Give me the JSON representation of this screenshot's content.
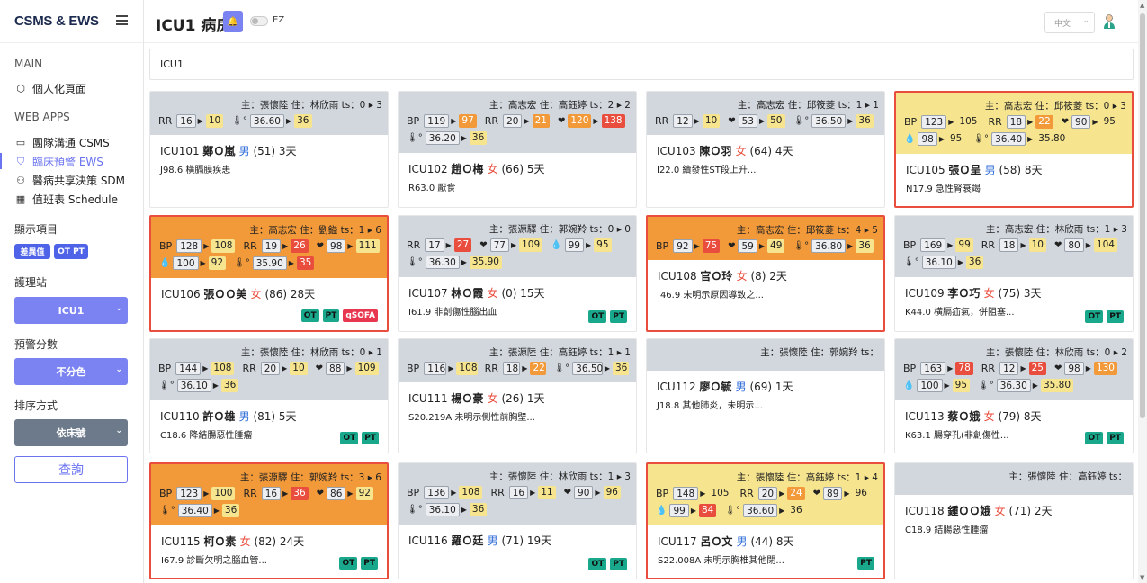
{
  "app": {
    "brand": "CSMS & EWS",
    "page_title": "ICU1 病房",
    "ez_label": "EZ",
    "lang": "中文"
  },
  "sidebar": {
    "main_section": "MAIN",
    "personal": "個人化頁面",
    "webapps_section": "WEB APPS",
    "items": [
      {
        "label": "團隊溝通 CSMS",
        "icon": "chat-icon"
      },
      {
        "label": "臨床預警 EWS",
        "icon": "shield-icon"
      },
      {
        "label": "醫病共享決策 SDM",
        "icon": "users-icon"
      },
      {
        "label": "值班表 Schedule",
        "icon": "calendar-icon"
      }
    ],
    "display_section": "顯示項目",
    "pills": [
      "差異值",
      "OT PT"
    ],
    "station_label": "護理站",
    "station_value": "ICU1",
    "score_label": "預警分數",
    "score_value": "不分色",
    "sort_label": "排序方式",
    "sort_value": "依床號",
    "query": "查詢"
  },
  "filter": {
    "value": "ICU1"
  },
  "cards": [
    {
      "theme": "gray",
      "alert": false,
      "doc": "主：張懷陸 住：林欣雨 ts：0 ▸ 3",
      "rows": [
        [
          [
            "label",
            "RR"
          ],
          [
            "g",
            "16"
          ],
          [
            "arr"
          ],
          [
            "y",
            "10"
          ],
          [
            "gap"
          ],
          [
            "ico",
            "🌡°"
          ],
          [
            "g",
            "36.60"
          ],
          [
            "arr"
          ],
          [
            "y",
            "36"
          ]
        ]
      ],
      "name": "ICU101",
      "pname": "鄭Ｏ嵐",
      "sex": "男",
      "sexc": "m",
      "info": "(51) 3天",
      "diag": "J98.6 橫膈膜疾患",
      "tags": []
    },
    {
      "theme": "gray",
      "alert": false,
      "doc": "主：高志宏 住：高鈺婷 ts：2 ▸ 2",
      "rows": [
        [
          [
            "label",
            "BP"
          ],
          [
            "g",
            "119"
          ],
          [
            "arr"
          ],
          [
            "o",
            "97"
          ],
          [
            "gap"
          ],
          [
            "label",
            "RR"
          ],
          [
            "g",
            "20"
          ],
          [
            "arr"
          ],
          [
            "o",
            "21"
          ],
          [
            "gap"
          ],
          [
            "ico",
            "❤"
          ],
          [
            "o",
            "120"
          ],
          [
            "arr"
          ],
          [
            "r",
            "138"
          ]
        ],
        [
          [
            "ico",
            "🌡°"
          ],
          [
            "g",
            "36.20"
          ],
          [
            "arr"
          ],
          [
            "y",
            "36"
          ]
        ]
      ],
      "name": "ICU102",
      "pname": "趙Ｏ梅",
      "sex": "女",
      "sexc": "f",
      "info": "(66) 5天",
      "diag": "R63.0 厭食",
      "tags": []
    },
    {
      "theme": "gray",
      "alert": false,
      "doc": "主：高志宏 住：邱筱菱 ts：1 ▸ 1",
      "rows": [
        [
          [
            "label",
            "RR"
          ],
          [
            "g",
            "12"
          ],
          [
            "arr"
          ],
          [
            "y",
            "10"
          ],
          [
            "gap"
          ],
          [
            "ico",
            "❤"
          ],
          [
            "g",
            "53"
          ],
          [
            "arr"
          ],
          [
            "y",
            "50"
          ],
          [
            "gap"
          ],
          [
            "ico",
            "🌡°"
          ],
          [
            "g",
            "36.50"
          ],
          [
            "arr"
          ],
          [
            "y",
            "36"
          ]
        ]
      ],
      "name": "ICU103",
      "pname": "陳Ｏ羽",
      "sex": "女",
      "sexc": "f",
      "info": "(64) 4天",
      "diag": "I22.0 續發性ST段上升...",
      "tags": []
    },
    {
      "theme": "yellow",
      "alert": true,
      "doc": "主：高志宏 住：邱筱菱 ts：0 ▸ 3",
      "rows": [
        [
          [
            "label",
            "BP"
          ],
          [
            "g",
            "123"
          ],
          [
            "arr"
          ],
          [
            "y",
            "105"
          ],
          [
            "gap"
          ],
          [
            "label",
            "RR"
          ],
          [
            "g",
            "18"
          ],
          [
            "arr"
          ],
          [
            "o",
            "22"
          ],
          [
            "gap"
          ],
          [
            "ico",
            "❤"
          ],
          [
            "g",
            "90"
          ],
          [
            "arr"
          ],
          [
            "y",
            "95"
          ]
        ],
        [
          [
            "ico",
            "💧"
          ],
          [
            "g",
            "98"
          ],
          [
            "arr"
          ],
          [
            "y",
            "95"
          ],
          [
            "gap"
          ],
          [
            "ico",
            "🌡°"
          ],
          [
            "g",
            "36.40"
          ],
          [
            "arr"
          ],
          [
            "y",
            "35.80"
          ]
        ]
      ],
      "name": "ICU105",
      "pname": "張Ｏ呈",
      "sex": "男",
      "sexc": "m",
      "info": "(58) 8天",
      "diag": "N17.9 急性腎衰竭",
      "tags": []
    },
    {
      "theme": "orange",
      "alert": true,
      "doc": "主：高志宏 住：劉鎰 ts：1 ▸ 6",
      "rows": [
        [
          [
            "label",
            "BP"
          ],
          [
            "g",
            "128"
          ],
          [
            "arr"
          ],
          [
            "y",
            "108"
          ],
          [
            "gap"
          ],
          [
            "label",
            "RR"
          ],
          [
            "g",
            "19"
          ],
          [
            "arr"
          ],
          [
            "r",
            "26"
          ],
          [
            "gap"
          ],
          [
            "ico",
            "❤"
          ],
          [
            "g",
            "98"
          ],
          [
            "arr"
          ],
          [
            "y",
            "111"
          ]
        ],
        [
          [
            "ico",
            "💧"
          ],
          [
            "g",
            "100"
          ],
          [
            "arr"
          ],
          [
            "y",
            "92"
          ],
          [
            "gap"
          ],
          [
            "ico",
            "🌡°"
          ],
          [
            "g",
            "35.90"
          ],
          [
            "arr"
          ],
          [
            "r",
            "35"
          ]
        ]
      ],
      "name": "ICU106",
      "pname": "張ＯＯ美",
      "sex": "女",
      "sexc": "f",
      "info": "(86) 28天",
      "diag": "",
      "tags": [
        "OT",
        "PT",
        "qSOFA"
      ]
    },
    {
      "theme": "gray",
      "alert": false,
      "doc": "主：張源驛 住：郭婉羚 ts：0 ▸ 0",
      "rows": [
        [
          [
            "label",
            "RR"
          ],
          [
            "g",
            "17"
          ],
          [
            "arr"
          ],
          [
            "r",
            "27"
          ],
          [
            "gap"
          ],
          [
            "ico",
            "❤"
          ],
          [
            "g",
            "77"
          ],
          [
            "arr"
          ],
          [
            "y",
            "109"
          ],
          [
            "gap"
          ],
          [
            "ico",
            "💧"
          ],
          [
            "g",
            "99"
          ],
          [
            "arr"
          ],
          [
            "y",
            "95"
          ]
        ],
        [
          [
            "ico",
            "🌡°"
          ],
          [
            "g",
            "36.30"
          ],
          [
            "arr"
          ],
          [
            "y",
            "35.90"
          ]
        ]
      ],
      "name": "ICU107",
      "pname": "林Ｏ霞",
      "sex": "女",
      "sexc": "f",
      "info": "(0) 15天",
      "diag": "I61.9 非創傷性腦出血",
      "tags": [
        "OT",
        "PT"
      ]
    },
    {
      "theme": "orange",
      "alert": true,
      "doc": "主：高志宏 住：邱筱菱 ts：4 ▸ 5",
      "rows": [
        [
          [
            "label",
            "BP"
          ],
          [
            "g",
            "92"
          ],
          [
            "arr"
          ],
          [
            "r",
            "75"
          ],
          [
            "gap"
          ],
          [
            "ico",
            "❤"
          ],
          [
            "g",
            "59"
          ],
          [
            "arr"
          ],
          [
            "y",
            "49"
          ],
          [
            "gap"
          ],
          [
            "ico",
            "🌡°"
          ],
          [
            "g",
            "36.80"
          ],
          [
            "arr"
          ],
          [
            "y",
            "36"
          ]
        ]
      ],
      "name": "ICU108",
      "pname": "官Ｏ玲",
      "sex": "女",
      "sexc": "f",
      "info": "(8) 2天",
      "diag": "I46.9 未明示原因導致之...",
      "tags": []
    },
    {
      "theme": "gray",
      "alert": false,
      "doc": "主：高志宏 住：林欣雨 ts：1 ▸ 3",
      "rows": [
        [
          [
            "label",
            "BP"
          ],
          [
            "g",
            "169"
          ],
          [
            "arr"
          ],
          [
            "y",
            "99"
          ],
          [
            "gap"
          ],
          [
            "label",
            "RR"
          ],
          [
            "g",
            "18"
          ],
          [
            "arr"
          ],
          [
            "y",
            "10"
          ],
          [
            "gap"
          ],
          [
            "ico",
            "❤"
          ],
          [
            "g",
            "80"
          ],
          [
            "arr"
          ],
          [
            "y",
            "104"
          ]
        ],
        [
          [
            "ico",
            "🌡°"
          ],
          [
            "g",
            "36.10"
          ],
          [
            "arr"
          ],
          [
            "y",
            "36"
          ]
        ]
      ],
      "name": "ICU109",
      "pname": "李Ｏ巧",
      "sex": "女",
      "sexc": "f",
      "info": "(75) 3天",
      "diag": "K44.0 橫膈疝氣，併阻塞...",
      "tags": [
        "OT",
        "PT"
      ]
    },
    {
      "theme": "gray",
      "alert": false,
      "doc": "主：張懷陸 住：林欣雨 ts：0 ▸ 1",
      "rows": [
        [
          [
            "label",
            "BP"
          ],
          [
            "g",
            "144"
          ],
          [
            "arr"
          ],
          [
            "y",
            "108"
          ],
          [
            "gap"
          ],
          [
            "label",
            "RR"
          ],
          [
            "g",
            "20"
          ],
          [
            "arr"
          ],
          [
            "y",
            "10"
          ],
          [
            "gap"
          ],
          [
            "ico",
            "❤"
          ],
          [
            "g",
            "88"
          ],
          [
            "arr"
          ],
          [
            "y",
            "109"
          ]
        ],
        [
          [
            "ico",
            "🌡°"
          ],
          [
            "g",
            "36.10"
          ],
          [
            "arr"
          ],
          [
            "y",
            "36"
          ]
        ]
      ],
      "name": "ICU110",
      "pname": "許Ｏ雄",
      "sex": "男",
      "sexc": "m",
      "info": "(81) 5天",
      "diag": "C18.6 降結腸惡性腫瘤",
      "tags": [
        "OT",
        "PT"
      ]
    },
    {
      "theme": "gray",
      "alert": false,
      "doc": "主：張源陸 住：高鈺婷 ts：1 ▸ 1",
      "rows": [
        [
          [
            "label",
            "BP"
          ],
          [
            "g",
            "116"
          ],
          [
            "arr"
          ],
          [
            "y",
            "108"
          ],
          [
            "gap"
          ],
          [
            "label",
            "RR"
          ],
          [
            "g",
            "18"
          ],
          [
            "arr"
          ],
          [
            "o",
            "22"
          ],
          [
            "gap"
          ],
          [
            "ico",
            "🌡°"
          ],
          [
            "g",
            "36.50"
          ],
          [
            "arr"
          ],
          [
            "y",
            "36"
          ]
        ]
      ],
      "name": "ICU111",
      "pname": "楊Ｏ豪",
      "sex": "女",
      "sexc": "f",
      "info": "(26) 1天",
      "diag": "S20.219A 未明示側性前胸壁...",
      "tags": []
    },
    {
      "theme": "gray",
      "alert": false,
      "doc": "主：張懷陸 住：郭婉羚 ts：",
      "rows": [],
      "name": "ICU112",
      "pname": "廖Ｏ毓",
      "sex": "男",
      "sexc": "m",
      "info": "(69) 1天",
      "diag": "J18.8 其他肺炎，未明示...",
      "tags": []
    },
    {
      "theme": "gray",
      "alert": false,
      "doc": "主：張懷陸 住：林欣雨 ts：0 ▸ 2",
      "rows": [
        [
          [
            "label",
            "BP"
          ],
          [
            "g",
            "163"
          ],
          [
            "arr"
          ],
          [
            "r",
            "78"
          ],
          [
            "gap"
          ],
          [
            "label",
            "RR"
          ],
          [
            "g",
            "12"
          ],
          [
            "arr"
          ],
          [
            "r",
            "25"
          ],
          [
            "gap"
          ],
          [
            "ico",
            "❤"
          ],
          [
            "g",
            "98"
          ],
          [
            "arr"
          ],
          [
            "o",
            "130"
          ]
        ],
        [
          [
            "ico",
            "💧"
          ],
          [
            "g",
            "100"
          ],
          [
            "arr"
          ],
          [
            "y",
            "95"
          ],
          [
            "gap"
          ],
          [
            "ico",
            "🌡°"
          ],
          [
            "g",
            "36.30"
          ],
          [
            "arr"
          ],
          [
            "y",
            "35.80"
          ]
        ]
      ],
      "name": "ICU113",
      "pname": "蔡Ｏ娥",
      "sex": "女",
      "sexc": "f",
      "info": "(79) 8天",
      "diag": "K63.1 腸穿孔(非創傷性...",
      "tags": [
        "OT",
        "PT"
      ]
    },
    {
      "theme": "orange",
      "alert": true,
      "doc": "主：張源驛 住：郭婉羚 ts：3 ▸ 6",
      "rows": [
        [
          [
            "label",
            "BP"
          ],
          [
            "g",
            "123"
          ],
          [
            "arr"
          ],
          [
            "y",
            "100"
          ],
          [
            "gap"
          ],
          [
            "label",
            "RR"
          ],
          [
            "g",
            "16"
          ],
          [
            "arr"
          ],
          [
            "r",
            "36"
          ],
          [
            "gap"
          ],
          [
            "ico",
            "❤"
          ],
          [
            "g",
            "86"
          ],
          [
            "arr"
          ],
          [
            "y",
            "92"
          ]
        ],
        [
          [
            "ico",
            "🌡°"
          ],
          [
            "g",
            "36.40"
          ],
          [
            "arr"
          ],
          [
            "y",
            "36"
          ]
        ]
      ],
      "name": "ICU115",
      "pname": "柯Ｏ素",
      "sex": "女",
      "sexc": "f",
      "info": "(82) 24天",
      "diag": "I67.9 診斷欠明之腦血管...",
      "tags": [
        "OT",
        "PT"
      ]
    },
    {
      "theme": "gray",
      "alert": false,
      "doc": "主：張懷陸 住：林欣雨 ts：1 ▸ 3",
      "rows": [
        [
          [
            "label",
            "BP"
          ],
          [
            "g",
            "136"
          ],
          [
            "arr"
          ],
          [
            "y",
            "108"
          ],
          [
            "gap"
          ],
          [
            "label",
            "RR"
          ],
          [
            "g",
            "16"
          ],
          [
            "arr"
          ],
          [
            "y",
            "11"
          ],
          [
            "gap"
          ],
          [
            "ico",
            "❤"
          ],
          [
            "g",
            "90"
          ],
          [
            "arr"
          ],
          [
            "y",
            "96"
          ]
        ],
        [
          [
            "ico",
            "🌡°"
          ],
          [
            "g",
            "36.10"
          ],
          [
            "arr"
          ],
          [
            "y",
            "36"
          ]
        ]
      ],
      "name": "ICU116",
      "pname": "羅Ｏ廷",
      "sex": "男",
      "sexc": "m",
      "info": "(71) 19天",
      "diag": "",
      "tags": [
        "OT",
        "PT"
      ]
    },
    {
      "theme": "yellow",
      "alert": true,
      "doc": "主：張懷陸 住：高鈺婷 ts：1 ▸ 4",
      "rows": [
        [
          [
            "label",
            "BP"
          ],
          [
            "g",
            "148"
          ],
          [
            "arr"
          ],
          [
            "y",
            "105"
          ],
          [
            "gap"
          ],
          [
            "label",
            "RR"
          ],
          [
            "g",
            "20"
          ],
          [
            "arr"
          ],
          [
            "o",
            "24"
          ],
          [
            "gap"
          ],
          [
            "ico",
            "❤"
          ],
          [
            "g",
            "89"
          ],
          [
            "arr"
          ],
          [
            "y",
            "96"
          ]
        ],
        [
          [
            "ico",
            "💧"
          ],
          [
            "g",
            "99"
          ],
          [
            "arr"
          ],
          [
            "r",
            "84"
          ],
          [
            "gap"
          ],
          [
            "ico",
            "🌡°"
          ],
          [
            "g",
            "36.60"
          ],
          [
            "arr"
          ],
          [
            "y",
            "36"
          ]
        ]
      ],
      "name": "ICU117",
      "pname": "呂Ｏ文",
      "sex": "男",
      "sexc": "m",
      "info": "(44) 8天",
      "diag": "S22.008A 未明示胸椎其他閉...",
      "tags": [
        "PT"
      ]
    },
    {
      "theme": "gray",
      "alert": false,
      "doc": "主：張懷陸 住：高鈺婷 ts：",
      "rows": [],
      "name": "ICU118",
      "pname": "鍾ＯＯ娥",
      "sex": "女",
      "sexc": "f",
      "info": "(71) 2天",
      "diag": "C18.9 結腸惡性腫瘤",
      "tags": []
    }
  ]
}
